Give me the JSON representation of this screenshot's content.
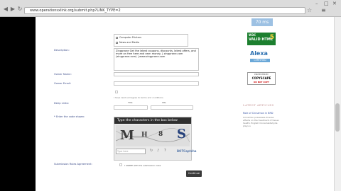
{
  "browser": {
    "url": "www.operationsxlink.org/submit.php?LINK_TYPE=2",
    "back_glyph": "◀",
    "forward_glyph": "▶",
    "reload_glyph": "↻",
    "star_glyph": "☆",
    "menu_glyph": "≡",
    "min_glyph": "–",
    "max_glyph": "□",
    "close_glyph": "✕"
  },
  "form": {
    "categories": [
      "Computer Printers",
      "News and Media"
    ],
    "description_label": "Description:",
    "description_text": "Zingprane Get the latest coupons, discounts, latest offers, and more on free here and earn money, | zingprane.com (zingprane.com) | www.zingprane.com",
    "owner_name_label": "Owner Name:",
    "owner_email_label": "Owner Email:",
    "terms_note": "I have read and agree to terms and conditions",
    "deep_links_label": "Deep Links:",
    "deep_links_title_col": "Title",
    "deep_links_url_col": "URL",
    "captcha_label": "* Enter the code shown:",
    "captcha_header": "Type the characters in the box below",
    "captcha_chars": [
      "M",
      "H",
      "8",
      "S"
    ],
    "captcha_placeholder": "Type here",
    "captcha_brand": "BOTCaptcha",
    "submission_rules_label": "Submission Rules Agreement:",
    "agree_text": "I AGREE with the submission rules",
    "continue_label": "Continue"
  },
  "sidebar": {
    "badge_top": "70 ms",
    "w3c_line1": "W3C",
    "w3c_line2": "VALID HTML",
    "w3c_number": "5",
    "alexa_title": "Alexa",
    "alexa_sub": "CERTIFIED",
    "copyscape_line1": "PROTECTED BY",
    "copyscape_line2": "COPYSCAPE",
    "copyscape_line3": "DO NOT COPY",
    "section_heading": "LATEST ARTICLES",
    "article_title": "Role of Cinnamon in BRD",
    "article_text": "Cinnamon possesses diverse effects on the treatment of tissue health, English Cinnamaldehyde plays a"
  }
}
